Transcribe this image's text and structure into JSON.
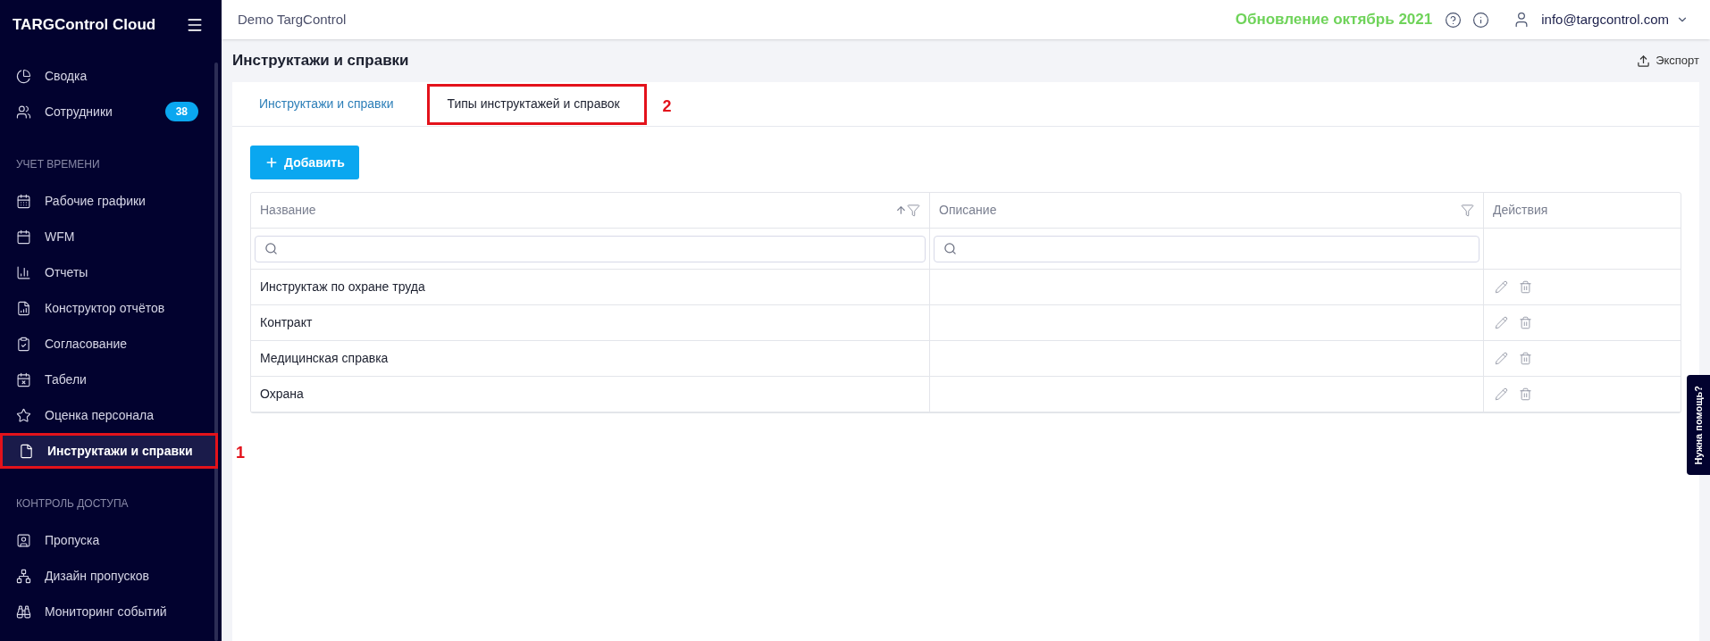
{
  "sidebar": {
    "brand": "TARGControl Cloud",
    "sections": [
      {
        "items": [
          {
            "label": "Сводка",
            "selected": false
          },
          {
            "label": "Сотрудники",
            "badge": "38",
            "selected": false
          }
        ]
      },
      {
        "heading": "УЧЕТ ВРЕМЕНИ",
        "items": [
          {
            "label": "Рабочие графики",
            "selected": false
          },
          {
            "label": "WFM",
            "selected": false
          },
          {
            "label": "Отчеты",
            "selected": false
          },
          {
            "label": "Конструктор отчётов",
            "selected": false
          },
          {
            "label": "Согласование",
            "selected": false
          },
          {
            "label": "Табели",
            "selected": false
          },
          {
            "label": "Оценка персонала",
            "selected": false
          },
          {
            "label": "Инструктажи и справки",
            "selected": true,
            "annotation": "1"
          }
        ]
      },
      {
        "heading": "КОНТРОЛЬ ДОСТУПА",
        "items": [
          {
            "label": "Пропуска",
            "selected": false
          },
          {
            "label": "Дизайн пропусков",
            "selected": false
          },
          {
            "label": "Мониторинг событий",
            "selected": false
          }
        ]
      }
    ]
  },
  "topbar": {
    "org": "Demo TargControl",
    "update": "Обновление октябрь 2021",
    "user": "info@targcontrol.com"
  },
  "page": {
    "title": "Инструктажи и справки",
    "export": "Экспорт"
  },
  "tabs": [
    {
      "label": "Инструктажи и справки",
      "selected": false
    },
    {
      "label": "Типы инструктажей и справок",
      "selected": true,
      "annotation": "2"
    }
  ],
  "add_button": "Добавить",
  "table": {
    "columns": [
      {
        "label": "Название",
        "sortable": true,
        "filter": true
      },
      {
        "label": "Описание",
        "sortable": false,
        "filter": true
      },
      {
        "label": "Действия",
        "sortable": false,
        "filter": false
      }
    ],
    "rows": [
      {
        "name": "Инструктаж по охране труда"
      },
      {
        "name": "Контракт"
      },
      {
        "name": "Медицинская справка"
      },
      {
        "name": "Охрана"
      }
    ]
  },
  "help_tab": "Нужна помощь?"
}
